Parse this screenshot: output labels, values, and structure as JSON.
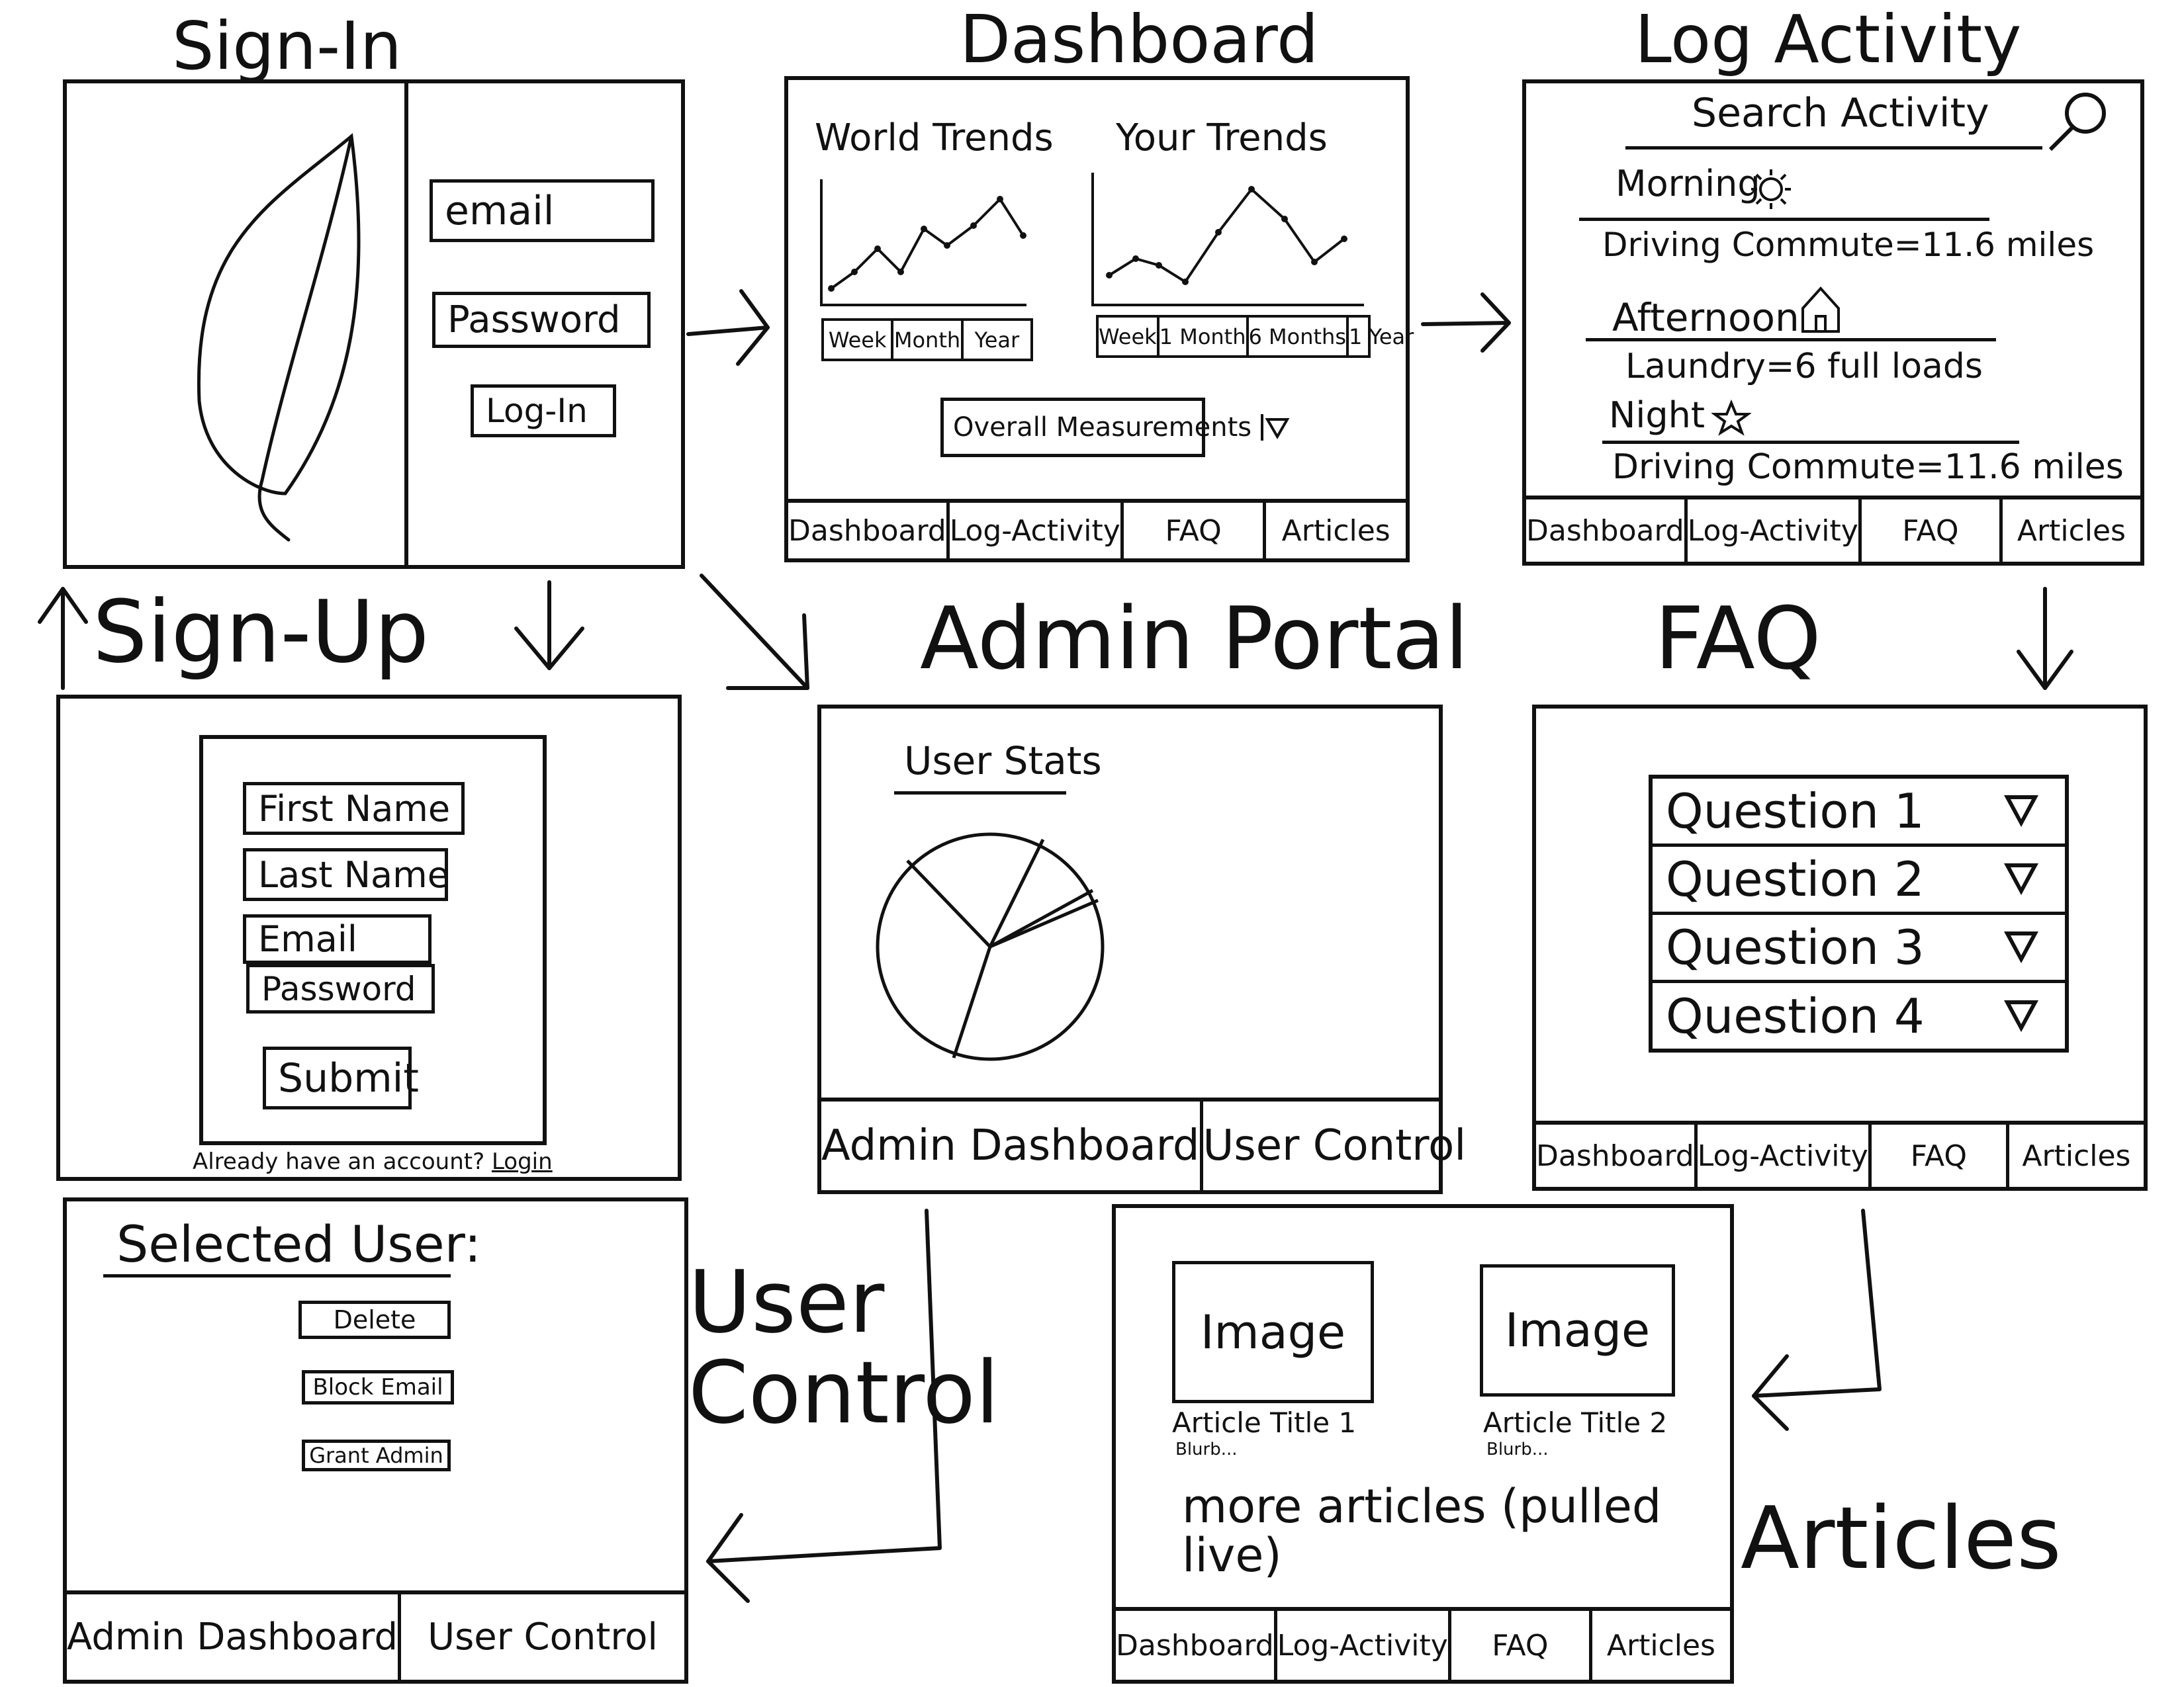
{
  "titles": {
    "signin": "Sign-In",
    "dashboard": "Dashboard",
    "log_activity": "Log Activity",
    "signup": "Sign-Up",
    "admin_portal": "Admin Portal",
    "faq": "FAQ",
    "user_control": "User Control",
    "articles": "Articles"
  },
  "signin": {
    "email": "email",
    "password": "Password",
    "login_button": "Log-In",
    "logo_icon": "leaf-icon"
  },
  "dashboard": {
    "world_trends": "World Trends",
    "your_trends": "Your Trends",
    "world_ranges": [
      "Week",
      "Month",
      "Year"
    ],
    "your_ranges": [
      "Week",
      "1 Month",
      "6 Months",
      "1 Year"
    ],
    "dropdown": "Overall Measurements"
  },
  "nav": {
    "dashboard": "Dashboard",
    "log_activity": "Log-Activity",
    "faq": "FAQ",
    "articles": "Articles"
  },
  "log": {
    "search": "Search Activity",
    "morning": "Morning",
    "morning_entry": "Driving Commute=11.6 miles",
    "afternoon": "Afternoon",
    "afternoon_entry": "Laundry=6 full loads",
    "night": "Night",
    "night_entry": "Driving Commute=11.6 miles"
  },
  "signup": {
    "first_name": "First Name",
    "last_name": "Last Name",
    "email": "Email",
    "password": "Password",
    "submit": "Submit",
    "already": "Already have an account?",
    "login_link": "Login"
  },
  "admin": {
    "user_stats": "User Stats",
    "nav_dashboard": "Admin Dashboard",
    "nav_control": "User Control"
  },
  "faq": {
    "questions": [
      "Question 1",
      "Question 2",
      "Question 3",
      "Question 4"
    ]
  },
  "user_control": {
    "selected_user": "Selected User:",
    "delete": "Delete",
    "block_email": "Block Email",
    "grant_admin": "Grant Admin",
    "nav_dashboard": "Admin Dashboard",
    "nav_control": "User Control"
  },
  "articles": {
    "image_label": "Image",
    "article1_title": "Article Title 1",
    "article2_title": "Article Title 2",
    "blurb": "Blurb...",
    "more": "more articles (pulled live)"
  }
}
